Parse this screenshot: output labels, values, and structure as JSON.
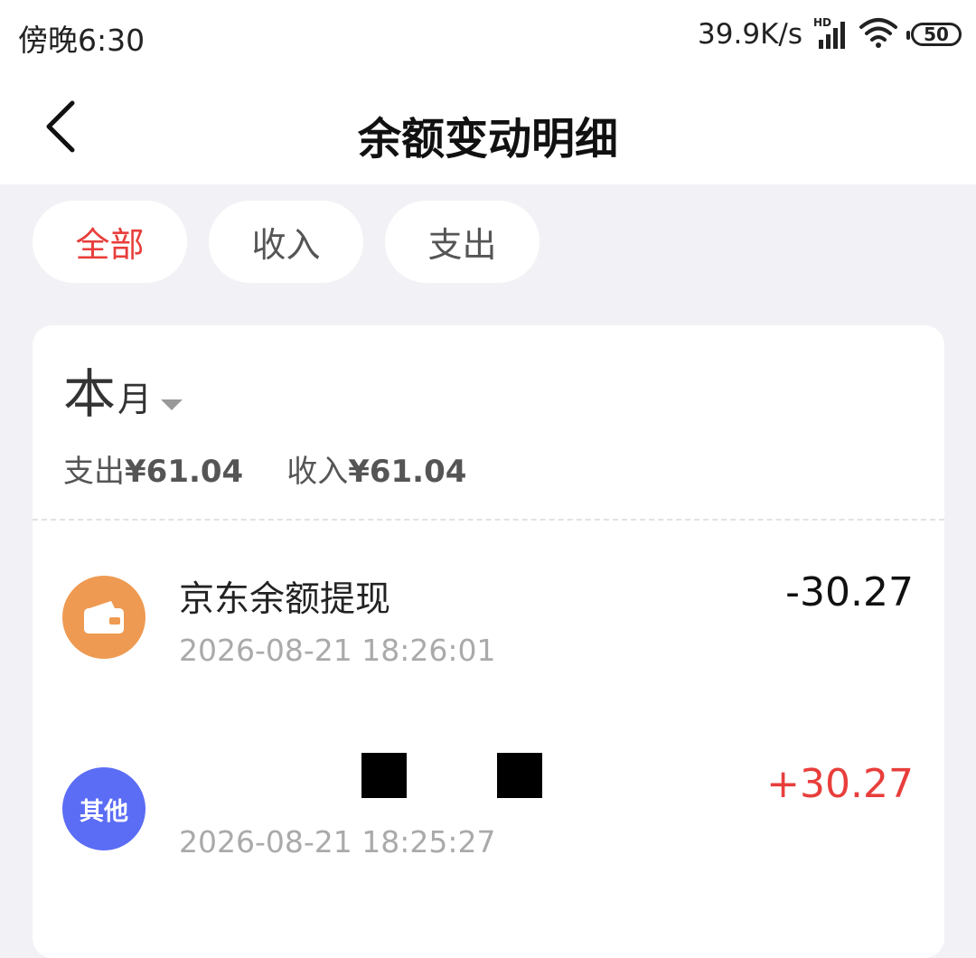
{
  "status_bar": {
    "time": "傍晚6:30",
    "network_speed": "39.9K/s",
    "signal_badge": "HD",
    "battery_level": "50"
  },
  "header": {
    "title": "余额变动明细"
  },
  "filter_tabs": [
    {
      "label": "全部",
      "active": true
    },
    {
      "label": "收入",
      "active": false
    },
    {
      "label": "支出",
      "active": false
    }
  ],
  "period": {
    "label_big": "本",
    "label_small": "月"
  },
  "summary": {
    "expense_label": "支出",
    "expense_amount": "¥61.04",
    "income_label": "收入",
    "income_amount": "¥61.04"
  },
  "transactions": [
    {
      "title": "京东余额提现",
      "time": "2026-08-21 18:26:01",
      "amount": "-30.27",
      "icon": "wallet-icon",
      "icon_color": "#ee9a52"
    },
    {
      "title": "",
      "time": "2026-08-21 18:25:27",
      "amount": "+30.27",
      "icon_text": "其他",
      "icon_color": "#5b6cf5"
    }
  ],
  "colors": {
    "accent_red": "#e83e3b",
    "background": "#f2f2f6"
  }
}
